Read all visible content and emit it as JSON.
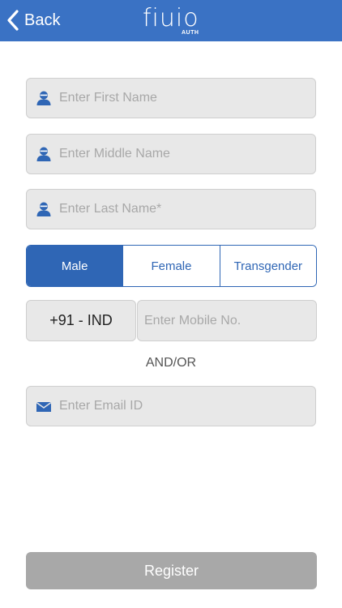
{
  "header": {
    "back_label": "Back",
    "logo_text": "fiuio",
    "logo_subtext": "AUTH",
    "back_icon": "chevron-left-icon"
  },
  "form": {
    "first_name": {
      "placeholder": "Enter First Name",
      "value": "",
      "icon": "user-icon"
    },
    "middle_name": {
      "placeholder": "Enter Middle Name",
      "value": "",
      "icon": "user-icon"
    },
    "last_name": {
      "placeholder": "Enter Last Name*",
      "value": "",
      "icon": "user-icon"
    },
    "gender": {
      "options": [
        "Male",
        "Female",
        "Transgender"
      ],
      "selected": "Male"
    },
    "country_code": "+91 - IND",
    "mobile": {
      "placeholder": "Enter Mobile No.",
      "value": ""
    },
    "andor_label": "AND/OR",
    "email": {
      "placeholder": "Enter Email ID",
      "value": "",
      "icon": "envelope-icon"
    },
    "register_label": "Register"
  },
  "colors": {
    "header_bg": "#3a72c4",
    "accent": "#2f66b5",
    "field_bg": "#e8e8e8",
    "register_disabled_bg": "#a8a8a8"
  }
}
